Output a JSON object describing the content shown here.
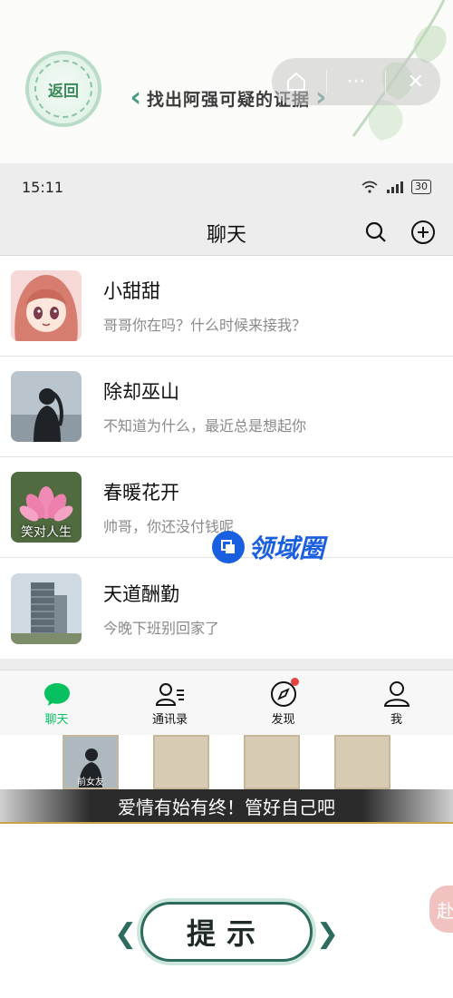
{
  "game": {
    "back_label": "返回",
    "level_title": "找出阿强可疑的证据",
    "hint_label": "提示",
    "subtitle": "爱情有始有终！管好自己吧",
    "float_label": "赴"
  },
  "phone": {
    "time": "15:11",
    "battery": "30",
    "header_title": "聊天",
    "chats": [
      {
        "name": "小甜甜",
        "message": "哥哥你在吗？什么时候来接我？",
        "avatar": "anime-girl-avatar"
      },
      {
        "name": "除却巫山",
        "message": "不知道为什么，最近总是想起你",
        "avatar": "silhouette-avatar"
      },
      {
        "name": "春暖花开",
        "message": "帅哥，你还没付钱呢",
        "avatar": "lotus-avatar",
        "avatar_caption": "笑对人生"
      },
      {
        "name": "天道酬勤",
        "message": "今晚下班别回家了",
        "avatar": "building-avatar"
      }
    ],
    "tabs": [
      {
        "label": "聊天",
        "icon": "chat-bubble-icon",
        "active": true
      },
      {
        "label": "通讯录",
        "icon": "contacts-icon",
        "active": false
      },
      {
        "label": "发现",
        "icon": "compass-icon",
        "active": false,
        "badge": true
      },
      {
        "label": "我",
        "icon": "person-icon",
        "active": false
      }
    ]
  },
  "evidence": {
    "slot1_caption": "前女友"
  },
  "watermark": {
    "text": "领域圈"
  },
  "colors": {
    "wechat_green": "#07c160",
    "accent_teal": "#2d6b5e",
    "slot_empty": "#d8cbb3",
    "badge_red": "#e64340"
  }
}
